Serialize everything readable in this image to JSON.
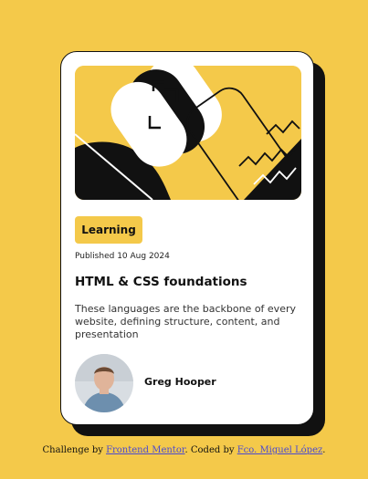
{
  "card": {
    "tag": "Learning",
    "published": "Published 10 Aug 2024",
    "title": "HTML & CSS foundations",
    "description": "These languages are the backbone of every website, defining structure, content, and presentation",
    "author": "Greg Hooper",
    "hero_icon": "abstract-illustration",
    "avatar_icon": "author-photo"
  },
  "footer": {
    "prefix": "Challenge by ",
    "link1": "Frontend Mentor",
    "middle": ". Coded by ",
    "link2": "Fco. Miguel López",
    "suffix": "."
  },
  "colors": {
    "background": "#f4c94a",
    "card": "#ffffff",
    "ink": "#111111",
    "link": "#4a4ad0"
  }
}
